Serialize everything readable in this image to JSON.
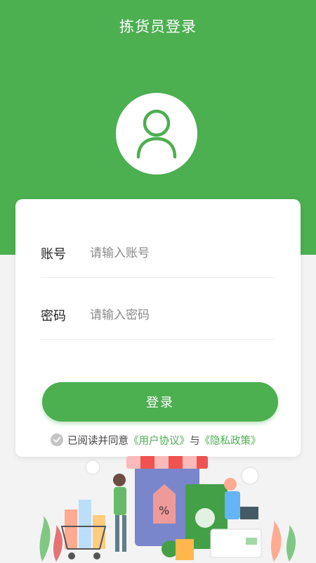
{
  "header": {
    "title": "拣货员登录"
  },
  "avatar": {
    "icon": "user-icon"
  },
  "form": {
    "account_label": "账号",
    "account_placeholder": "请输入账号",
    "account_value": "",
    "password_label": "密码",
    "password_placeholder": "请输入密码",
    "password_value": "",
    "login_label": "登录"
  },
  "agreement": {
    "checkbox_icon": "check-icon",
    "checked": false,
    "prefix": "已阅读并同意",
    "user_agreement": "《用户协议》",
    "conjunction": "与",
    "privacy_policy": "《隐私政策》"
  },
  "theme": {
    "primary": "#4caf50",
    "background": "#f3f3f3"
  },
  "illustration": {
    "icon": "shopping-illustration"
  }
}
